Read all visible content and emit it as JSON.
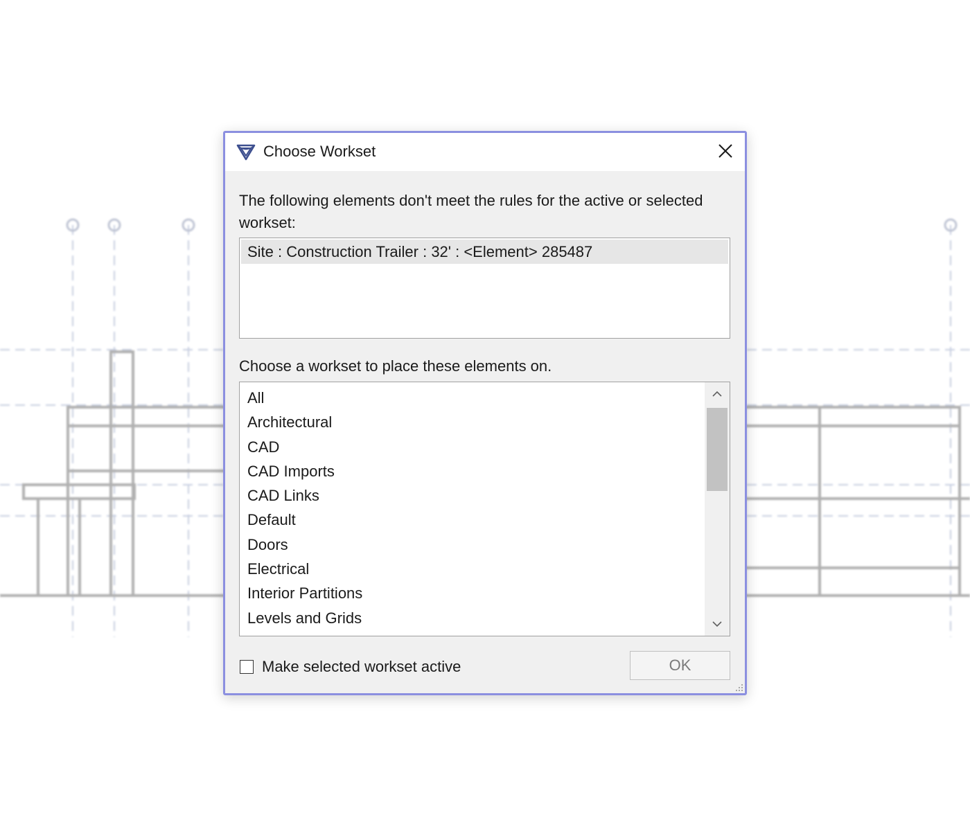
{
  "dialog": {
    "title": "Choose Workset",
    "app_icon": "revit-logo-icon",
    "close_icon": "close-icon",
    "message": "The following elements don't meet the rules for the active or selected workset:",
    "elements": [
      "Site : Construction Trailer : 32' : <Element> 285487"
    ],
    "choose_label": "Choose a workset to place these elements on.",
    "worksets": [
      "All",
      "Architectural",
      "CAD",
      "CAD Imports",
      "CAD Links",
      "Default",
      "Doors",
      "Electrical",
      "Interior Partitions",
      "Levels and Grids"
    ],
    "make_active_label": "Make selected workset active",
    "make_active_checked": false,
    "ok_label": "OK",
    "accent_color": "#8b8fe0",
    "brand_color": "#3d4f8f"
  }
}
